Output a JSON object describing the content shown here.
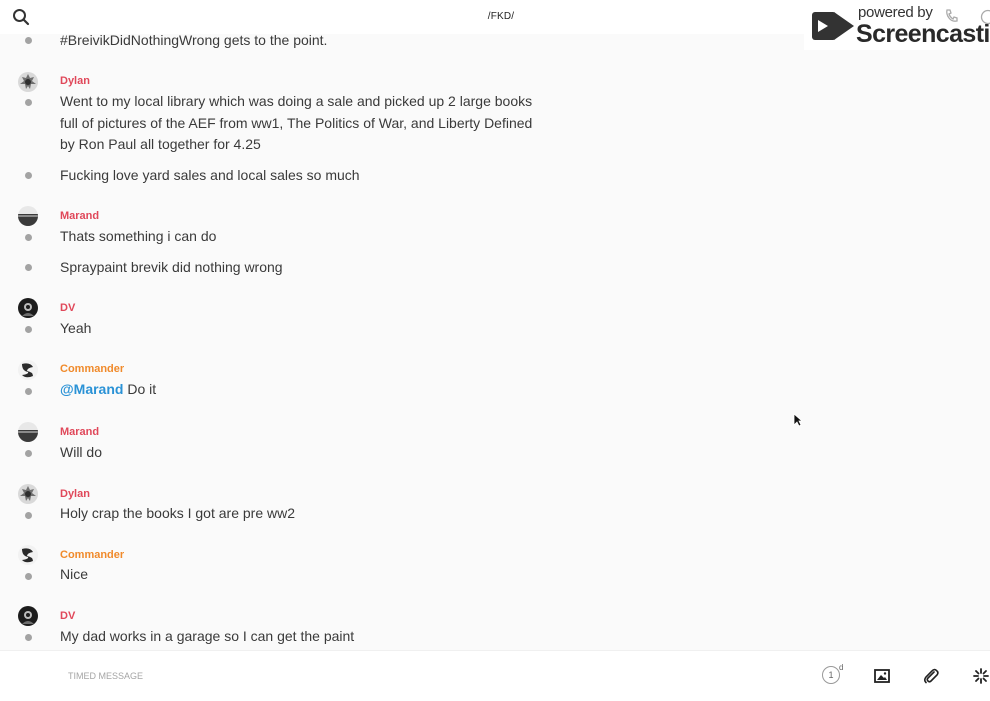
{
  "header": {
    "channel_title": "/FKD/"
  },
  "watermark": {
    "powered_by": "powered by",
    "brand": "Screencastify"
  },
  "messages": [
    {
      "author": "",
      "author_color": "",
      "text": "#BreivikDidNothingWrong gets to the point."
    },
    {
      "author": "Dylan",
      "author_color": "#e0485a",
      "text": "Went to my local library which was doing a sale and picked up 2 large books full of pictures of the AEF from ww1, The Politics of War, and Liberty Defined by Ron Paul all together for 4.25"
    },
    {
      "author": "",
      "author_color": "",
      "text": "Fucking love yard sales and local sales so much"
    },
    {
      "author": "Marand",
      "author_color": "#e0485a",
      "text": "Thats something i can do"
    },
    {
      "author": "",
      "author_color": "",
      "text": "Spraypaint brevik did nothing wrong"
    },
    {
      "author": "DV",
      "author_color": "#e0485a",
      "text": "Yeah"
    },
    {
      "author": "Commander",
      "author_color": "#f08a2b",
      "mention": "@Marand",
      "text": " Do it"
    },
    {
      "author": "Marand",
      "author_color": "#e0485a",
      "text": "Will do"
    },
    {
      "author": "Dylan",
      "author_color": "#e0485a",
      "text": "Holy crap the books I got are pre ww2"
    },
    {
      "author": "Commander",
      "author_color": "#f08a2b",
      "text": "Nice"
    },
    {
      "author": "DV",
      "author_color": "#e0485a",
      "text": "My dad works in a garage so I can get the paint"
    }
  ],
  "composer": {
    "placeholder": "TIMED MESSAGE",
    "timer_value": "1",
    "timer_unit": "d",
    "icons": [
      "image-icon",
      "paperclip-icon",
      "sparkle-icon"
    ]
  }
}
